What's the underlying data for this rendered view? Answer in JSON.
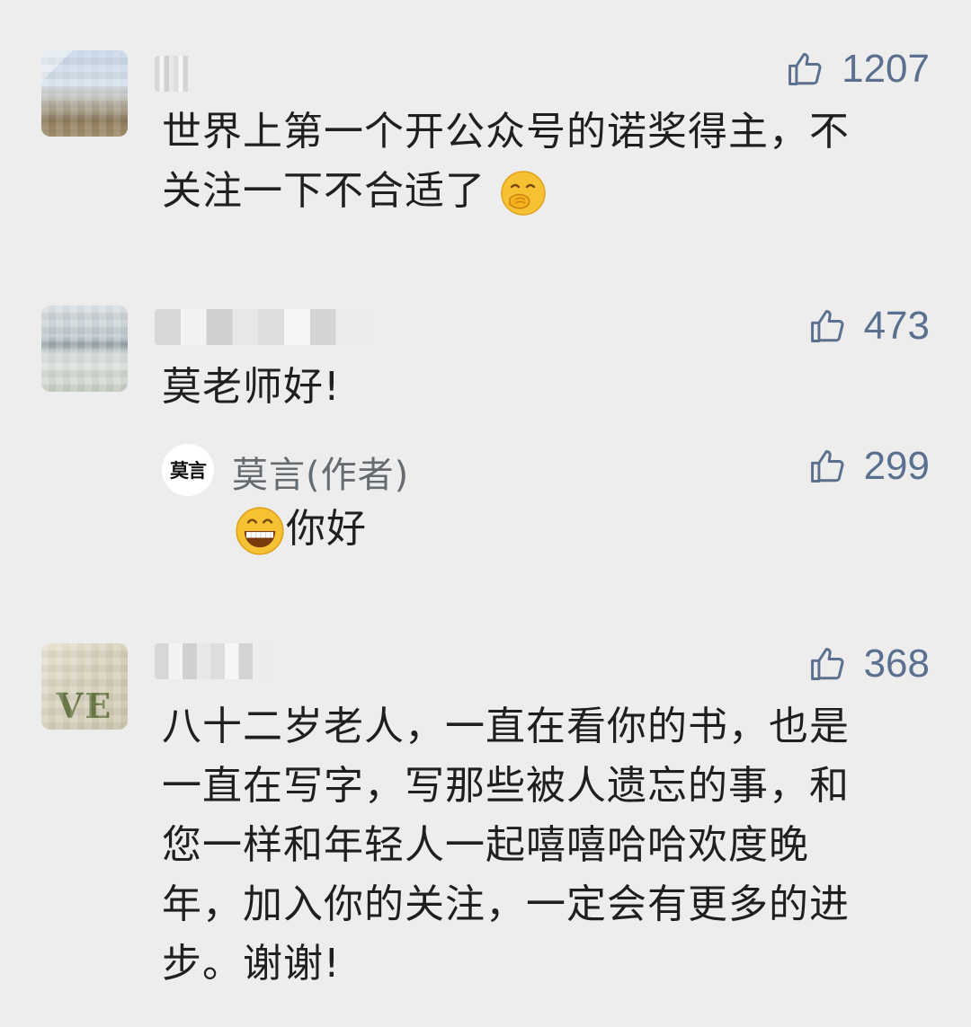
{
  "comments": [
    {
      "likes": "1207",
      "text_line1": "世界上第一个开公众号的诺奖得主，不",
      "text_line2": "关注一下不合适了",
      "emoji": "smirk-hand-over-mouth-emoji"
    },
    {
      "likes": "473",
      "text": "莫老师好!",
      "reply": {
        "avatar_text": "莫言",
        "name": "莫言(作者)",
        "likes": "299",
        "emoji": "grinning-emoji",
        "text": "你好"
      }
    },
    {
      "likes": "368",
      "avatar_text": "VE",
      "lines": [
        "八十二岁老人，一直在看你的书，也是",
        "一直在写字，写那些被人遗忘的事，和",
        "您一样和年轻人一起嘻嘻哈哈欢度晚",
        "年，加入你的关注，一定会有更多的进",
        "步。谢谢!"
      ]
    }
  ],
  "colors": {
    "background": "#ededed",
    "like": "#5b6f8f",
    "text": "#1f1f1f",
    "name": "#666b70"
  }
}
